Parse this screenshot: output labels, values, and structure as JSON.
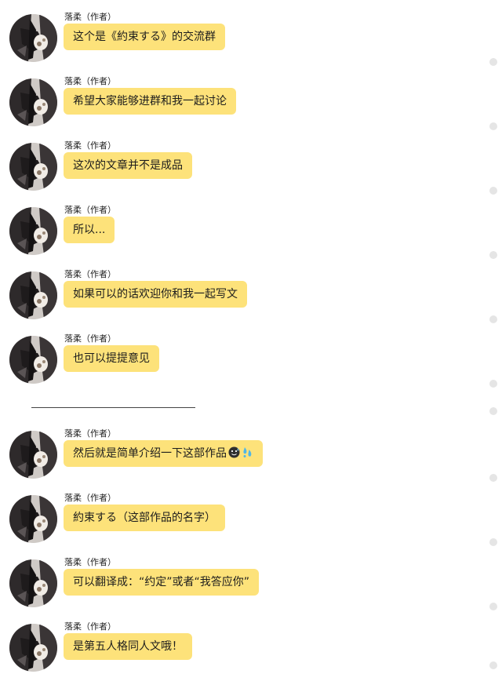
{
  "messages": [
    {
      "author": "落柔（作者）",
      "text": "这个是《約束する》的交流群"
    },
    {
      "author": "落柔（作者）",
      "text": "希望大家能够进群和我一起讨论"
    },
    {
      "author": "落柔（作者）",
      "text": "这次的文章并不是成品"
    },
    {
      "author": "落柔（作者）",
      "text": "所以..."
    },
    {
      "author": "落柔（作者）",
      "text": "如果可以的话欢迎你和我一起写文"
    },
    {
      "author": "落柔（作者）",
      "text": "也可以提提意见"
    },
    {
      "author": "落柔（作者）",
      "text": "然后就是简单介绍一下这部作品"
    },
    {
      "author": "落柔（作者）",
      "text": "約束する（这部作品的名字）"
    },
    {
      "author": "落柔（作者）",
      "text": "可以翻译成：“约定”或者“我答应你”"
    },
    {
      "author": "落柔（作者）",
      "text": "是第五人格同人文哦！"
    }
  ],
  "emojis": [
    "sweat-smile-emoji",
    "sweat-drops-emoji"
  ],
  "colors": {
    "bubble": "#fde27a",
    "background": "#ffffff",
    "divider": "#444444"
  }
}
